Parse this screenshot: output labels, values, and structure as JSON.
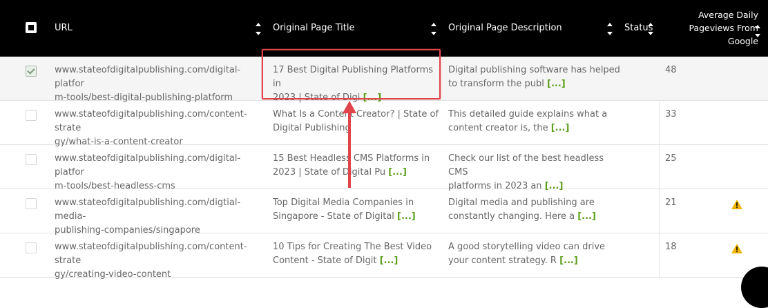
{
  "header": {
    "url": "URL",
    "title": "Original Page Title",
    "description": "Original Page Description",
    "status": "Status",
    "pageviews_line1": "Average Daily",
    "pageviews_line2": "Pageviews From",
    "pageviews_line3": "Google"
  },
  "more_label": "[...]",
  "rows": [
    {
      "url_line1": "www.stateofdigitalpublishing.com/digital-platfor",
      "url_line2": "m-tools/best-digital-publishing-platform",
      "title_line1": "17 Best Digital Publishing Platforms in",
      "title_line2": "2023 | State of Digi",
      "desc_line1": "Digital publishing software has helped",
      "desc_line2": "to transform the publ",
      "pageviews": "48",
      "checked": true,
      "warning": false
    },
    {
      "url_line1": "www.stateofdigitalpublishing.com/content-strate",
      "url_line2": "gy/what-is-a-content-creator",
      "title_line1": "What Is a Content Creator? | State of",
      "title_line2": "Digital Publishing",
      "desc_line1": "This detailed guide explains what a",
      "desc_line2": "content creator is, the",
      "pageviews": "33",
      "checked": false,
      "warning": false
    },
    {
      "url_line1": "www.stateofdigitalpublishing.com/digital-platfor",
      "url_line2": "m-tools/best-headless-cms",
      "title_line1": "15 Best Headless CMS Platforms in",
      "title_line2": "2023 | State of Digital Pu",
      "desc_line1": "Check our list of the best headless CMS",
      "desc_line2": "platforms in 2023 an",
      "pageviews": "25",
      "checked": false,
      "warning": false
    },
    {
      "url_line1": "www.stateofdigitalpublishing.com/digtial-media-",
      "url_line2": "publishing-companies/singapore",
      "title_line1": "Top Digital Media Companies in",
      "title_line2": "Singapore - State of Digital",
      "desc_line1": "Digital media and publishing are",
      "desc_line2": "constantly changing. Here a",
      "pageviews": "21",
      "checked": false,
      "warning": true
    },
    {
      "url_line1": "www.stateofdigitalpublishing.com/content-strate",
      "url_line2": "gy/creating-video-content",
      "title_line1": "10 Tips for Creating The Best Video",
      "title_line2": "Content - State of Digit",
      "desc_line1": "A good storytelling video can drive",
      "desc_line2": "your content strategy. R",
      "pageviews": "18",
      "checked": false,
      "warning": true
    }
  ],
  "colors": {
    "header_bg": "#000000",
    "more_link": "#5a9e1a",
    "highlight": "#e0454b",
    "warning": "#f0b400"
  }
}
